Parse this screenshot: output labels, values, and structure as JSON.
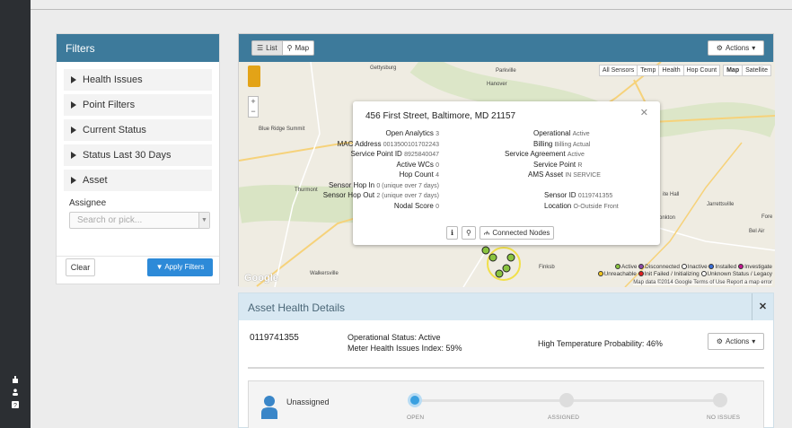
{
  "colors": {
    "header": "#3d7a9b",
    "accent": "#2d8ad8",
    "active_step": "#3aa0e0"
  },
  "filters": {
    "title": "Filters",
    "items": [
      {
        "label": "Health Issues"
      },
      {
        "label": "Point Filters"
      },
      {
        "label": "Current Status"
      },
      {
        "label": "Status Last 30 Days"
      },
      {
        "label": "Asset"
      }
    ],
    "assignee_label": "Assignee",
    "assignee_placeholder": "Search or pick...",
    "clear_label": "Clear",
    "apply_label": "Apply Filters"
  },
  "map_panel": {
    "view_list": "List",
    "view_map": "Map",
    "actions_label": "Actions",
    "map_types": [
      "All Sensors",
      "Temp",
      "Health",
      "Hop Count",
      "Map",
      "Satellite"
    ],
    "places": [
      "Gettysburg",
      "Hanover",
      "Blue Ridge Summit",
      "Thurmont",
      "Walkersville",
      "Finksb",
      "Monkton",
      "Jarrettsville",
      "Fore",
      "Bel Air",
      "ite Hall",
      "Parkville"
    ],
    "attribution": "Map data ©2014 Google  Terms of Use  Report a map error",
    "legend_line1": [
      "Active",
      "Disconnected",
      "Inactive",
      "Installed",
      "Investigate"
    ],
    "legend_line2": [
      "Unreachable",
      "Init Failed / Initializing",
      "Unknown Status / Legacy"
    ],
    "google": "Google"
  },
  "popup": {
    "address": "456 First Street, Baltimore, MD 21157",
    "left": [
      {
        "k": "Open Analytics",
        "v": "3"
      },
      {
        "k": "MAC Address",
        "v": "0013500101702243"
      },
      {
        "k": "Service Point ID",
        "v": "8925840047"
      },
      {
        "k": "Active WCs",
        "v": "0"
      },
      {
        "k": "Hop Count",
        "v": "4"
      },
      {
        "k": "Sensor Hop In",
        "v": "0 (unique over 7 days)"
      },
      {
        "k": "Sensor Hop Out",
        "v": "2 (unique over 7 days)"
      },
      {
        "k": "Nodal Score",
        "v": "0"
      }
    ],
    "right": [
      {
        "k": "Operational",
        "v": "Active"
      },
      {
        "k": "Billing",
        "v": "Billing Actual"
      },
      {
        "k": "Service Agreement",
        "v": "Active"
      },
      {
        "k": "Service Point",
        "v": "R"
      },
      {
        "k": "AMS Asset",
        "v": "IN SERVICE"
      },
      {
        "k": "Sensor ID",
        "v": "0119741355"
      },
      {
        "k": "Location",
        "v": "O-Outside Front"
      }
    ],
    "connected_nodes": "Connected Nodes"
  },
  "asset_health": {
    "title": "Asset Health Details",
    "id": "0119741355",
    "operational_status": "Operational Status: Active",
    "health_index": "Meter Health Issues Index: 59%",
    "temp_probability": "High Temperature Probability: 46%",
    "actions_label": "Actions",
    "assignee": "Unassigned",
    "steps": [
      {
        "label": "OPEN",
        "active": true
      },
      {
        "label": "ASSIGNED",
        "active": false
      },
      {
        "label": "NO ISSUES",
        "active": false
      }
    ]
  }
}
